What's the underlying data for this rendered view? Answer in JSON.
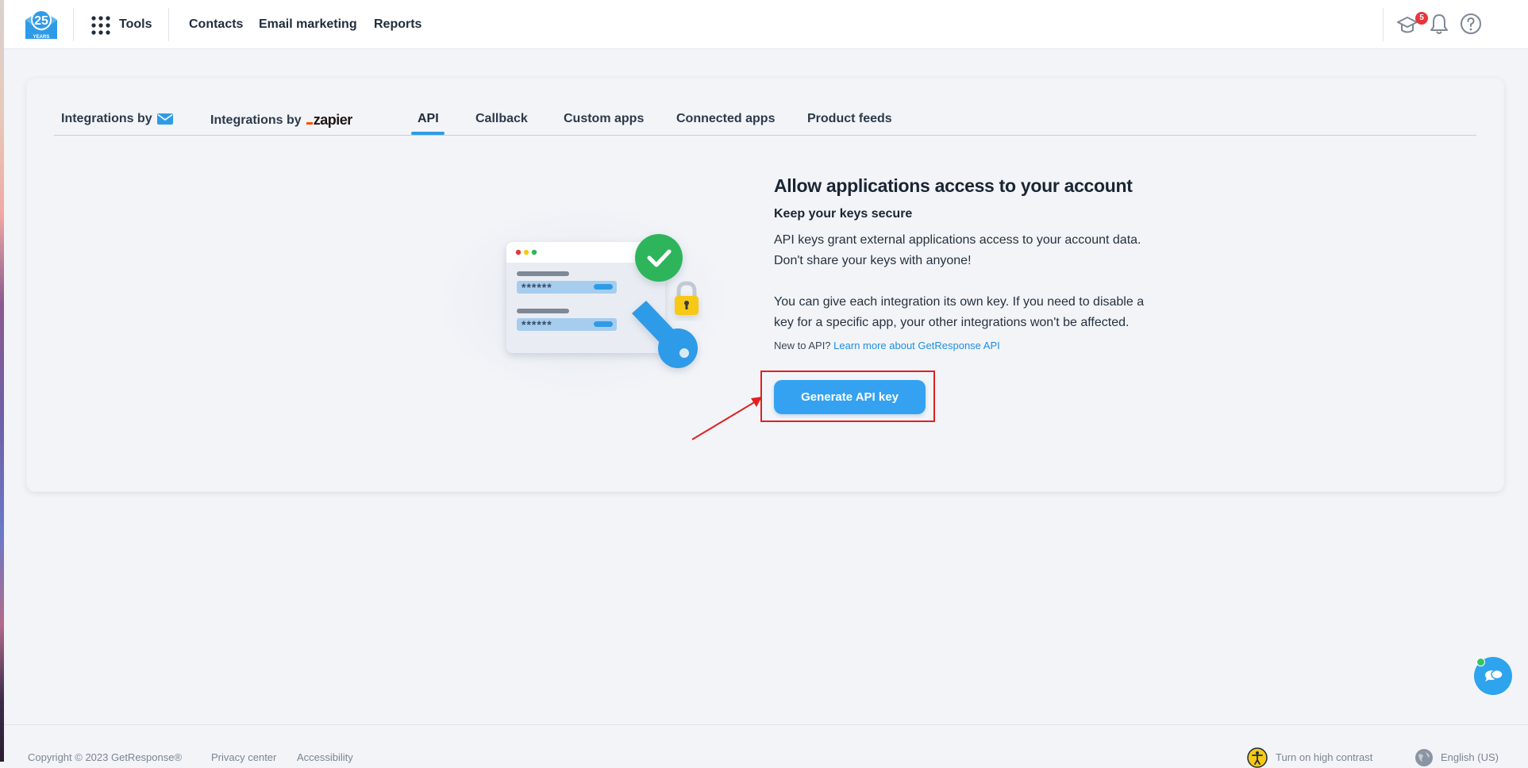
{
  "header": {
    "logo_text": "25",
    "logo_sub": "YEARS",
    "tools_label": "Tools",
    "nav": [
      "Contacts",
      "Email marketing",
      "Reports"
    ],
    "notification_count": "5"
  },
  "tabs": [
    {
      "label": "Integrations by",
      "icon": "envelope-icon",
      "active": false
    },
    {
      "label": "Integrations by",
      "logo_text": "zapier",
      "active": false
    },
    {
      "label": "API",
      "active": true
    },
    {
      "label": "Callback",
      "active": false
    },
    {
      "label": "Custom apps",
      "active": false
    },
    {
      "label": "Connected apps",
      "active": false
    },
    {
      "label": "Product feeds",
      "active": false
    }
  ],
  "content": {
    "headline": "Allow applications access to your account",
    "subhead": "Keep your keys secure",
    "para1_line1": "API keys grant external applications access to your account data.",
    "para1_line2": "Don't share your keys with anyone!",
    "para2_line1": "You can give each integration its own key. If you need to disable a",
    "para2_line2": "key for a specific app, your other integrations won't be affected.",
    "new_to_api": "New to API?",
    "learn_more_link": "Learn more about GetResponse API",
    "button_label": "Generate API key",
    "masked_key": "******"
  },
  "footer": {
    "copyright": "Copyright © 2023 GetResponse®",
    "privacy": "Privacy center",
    "accessibility": "Accessibility",
    "high_contrast": "Turn on high contrast",
    "language": "English (US)"
  },
  "colors": {
    "accent": "#34a2f0",
    "badge": "#e8353b",
    "highlight": "#e02020",
    "success": "#2fb55b",
    "lock": "#f6c915"
  }
}
